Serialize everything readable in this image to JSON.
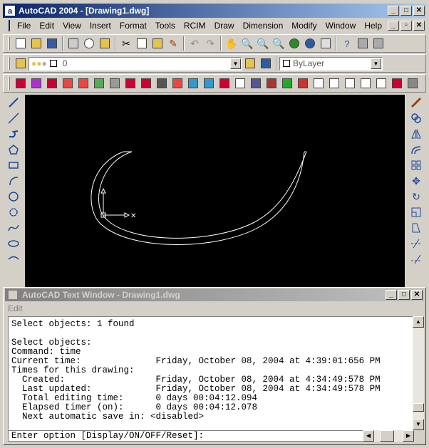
{
  "window": {
    "app_icon": "a",
    "title": "AutoCAD 2004 - [Drawing1.dwg]",
    "controls": [
      "_",
      "□",
      "✕"
    ]
  },
  "menubar": {
    "items": [
      "File",
      "Edit",
      "View",
      "Insert",
      "Format",
      "Tools",
      "RCIM",
      "Draw",
      "Dimension",
      "Modify",
      "Window",
      "Help"
    ],
    "doc_controls": [
      "_",
      "▫",
      "✕"
    ]
  },
  "layer_toolbar": {
    "layer_value": "0",
    "linetype_value": "ByLayer"
  },
  "text_window": {
    "title": "AutoCAD Text Window - Drawing1.dwg",
    "controls": [
      "_",
      "□",
      "✕"
    ],
    "menu_edit": "Edit",
    "lines": [
      "Select objects: 1 found",
      "",
      "Select objects:",
      "Command: time",
      "Current time:              Friday, October 08, 2004 at 4:39:01:656 PM",
      "Times for this drawing:",
      "  Created:                 Friday, October 08, 2004 at 4:34:49:578 PM",
      "  Last updated:            Friday, October 08, 2004 at 4:34:49:578 PM",
      "  Total editing time:      0 days 00:04:12.094",
      "  Elapsed timer (on):      0 days 00:04:12.078",
      "  Next automatic save in: <disabled>"
    ],
    "command_prompt": "Enter option [Display/ON/OFF/Reset]:"
  },
  "icons": {
    "standard": [
      "new-icon",
      "open-icon",
      "save-icon",
      "print-icon",
      "plot-preview-icon",
      "publish-icon",
      "cut-icon",
      "copy-icon",
      "paste-icon",
      "match-properties-icon",
      "undo-icon",
      "redo-icon",
      "pan-icon",
      "zoom-realtime-icon",
      "zoom-window-icon",
      "zoom-previous-icon",
      "properties-icon",
      "designcenter-icon",
      "tool-palettes-icon",
      "help-icon"
    ],
    "draw": [
      "line-icon",
      "construction-line-icon",
      "polyline-icon",
      "polygon-icon",
      "rectangle-icon",
      "arc-icon",
      "circle-icon",
      "revcloud-icon",
      "spline-icon",
      "ellipse-icon",
      "ellipse-arc-icon"
    ],
    "modify": [
      "erase-icon",
      "copy-object-icon",
      "mirror-icon",
      "offset-icon",
      "array-icon",
      "move-icon",
      "rotate-icon",
      "scale-icon",
      "stretch-icon",
      "trim-icon",
      "extend-icon"
    ]
  },
  "colors": {
    "titlebar_active": "#0a246a",
    "titlebar_inactive": "#808080",
    "drawing_background": "#000000",
    "face": "#d4d0c8"
  }
}
